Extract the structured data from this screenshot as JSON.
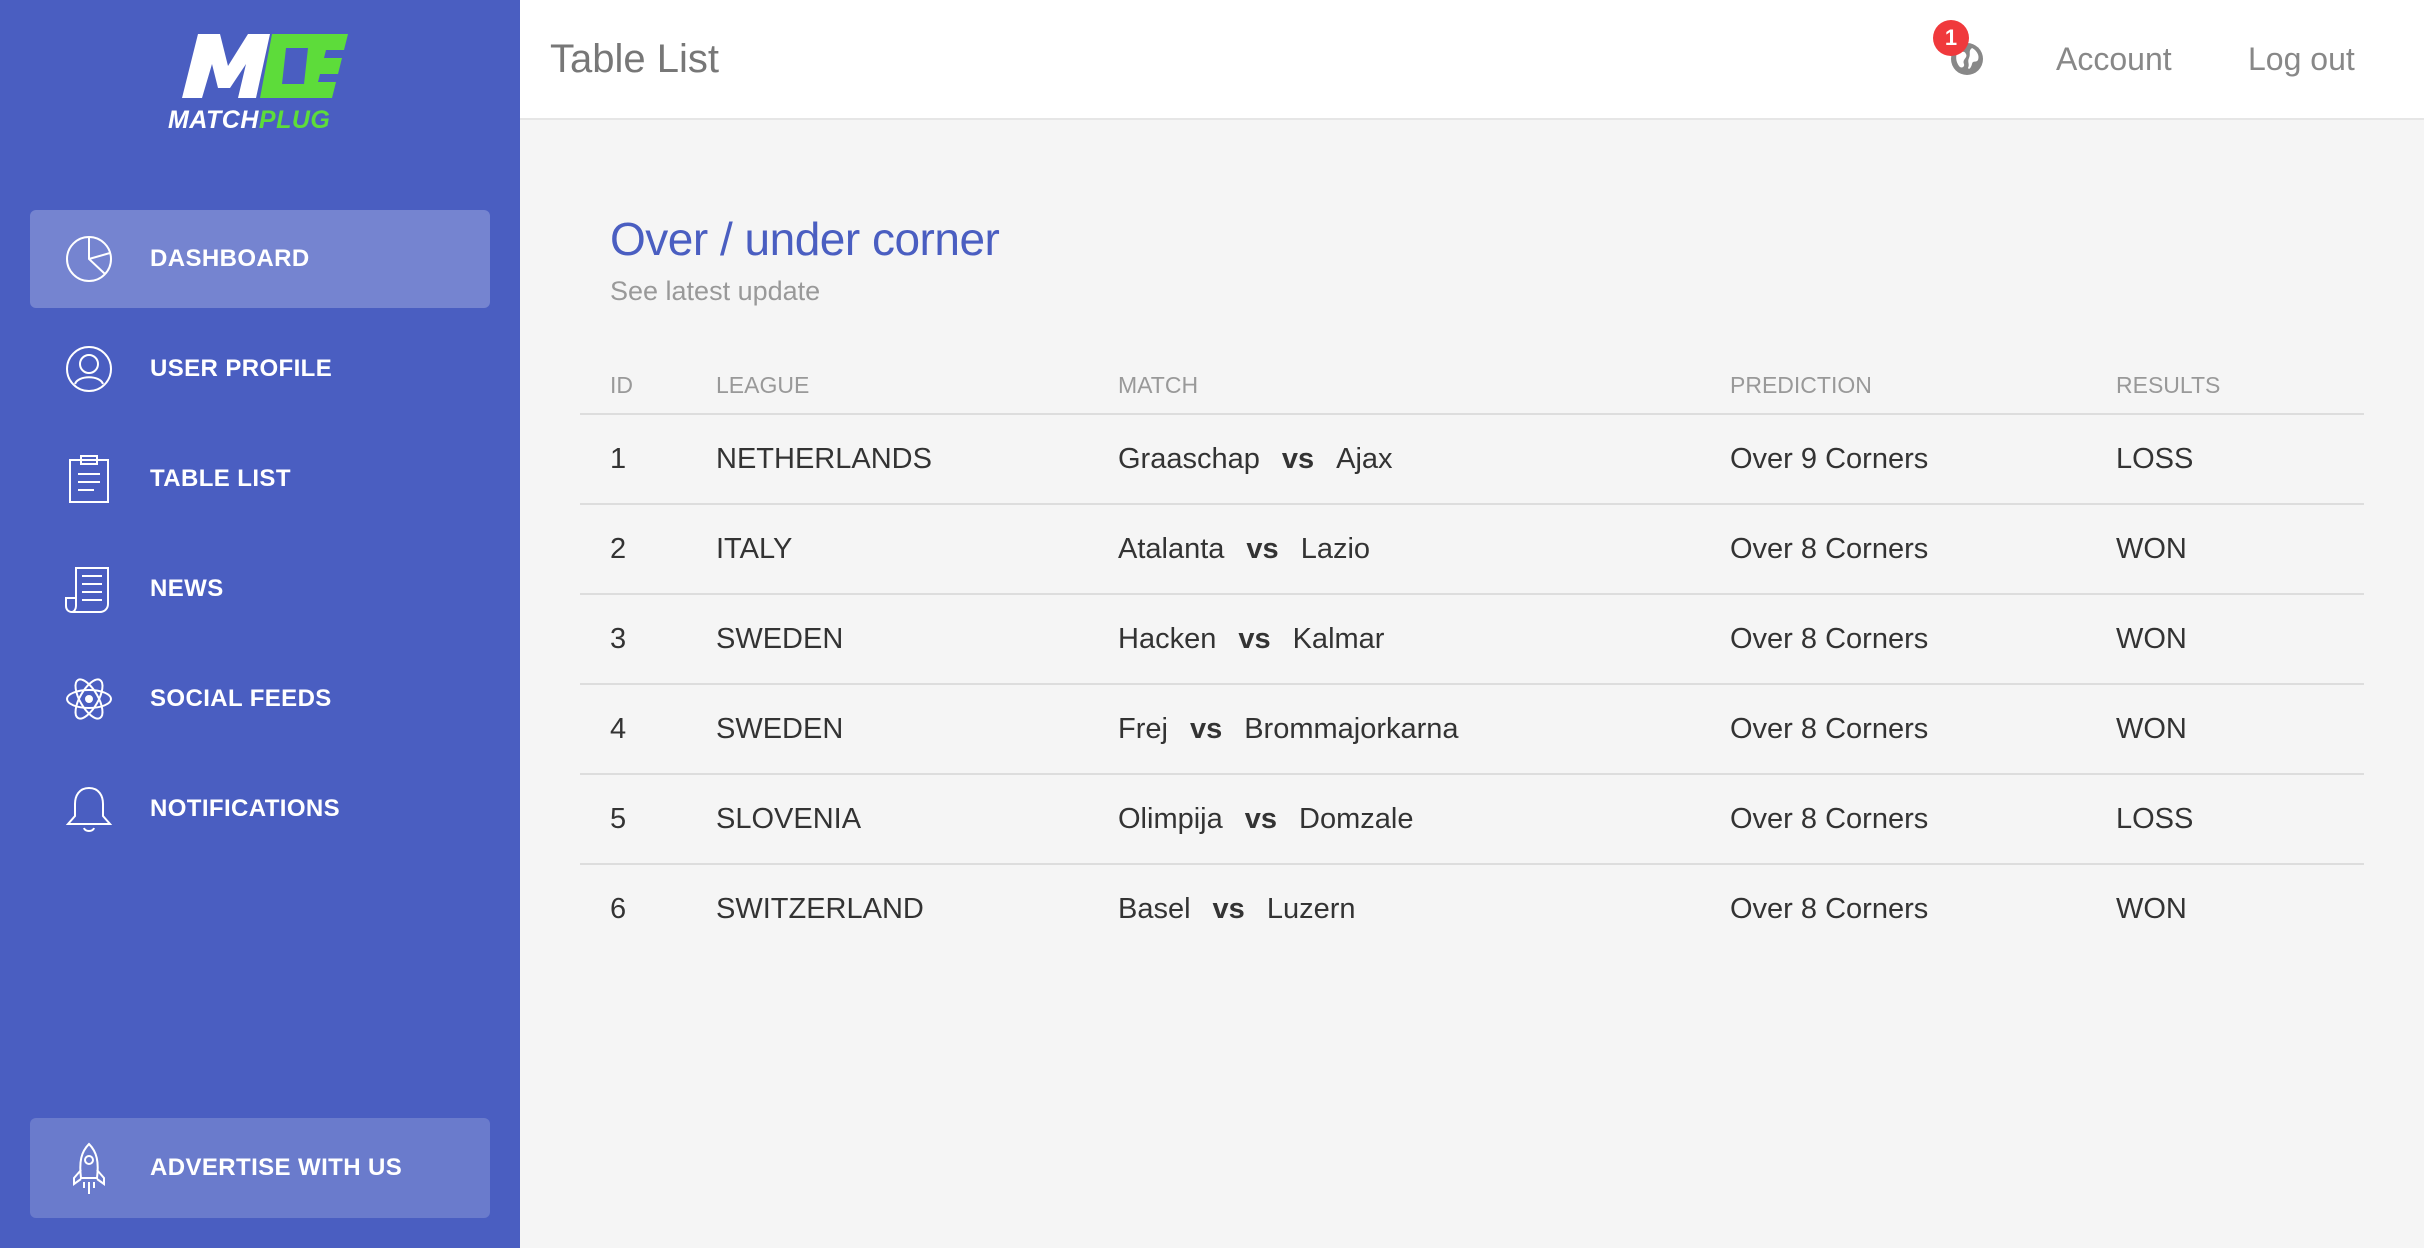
{
  "brand": {
    "logo_part1": "MATCH",
    "logo_part2": "PLUG",
    "colors": {
      "sidebar": "#4a5ec1",
      "accent_green": "#5ddc3a",
      "badge": "#f0393c"
    }
  },
  "sidebar": {
    "items": [
      {
        "label": "DASHBOARD",
        "icon": "pie-chart-icon",
        "active": true
      },
      {
        "label": "USER PROFILE",
        "icon": "user-icon"
      },
      {
        "label": "TABLE LIST",
        "icon": "clipboard-icon"
      },
      {
        "label": "NEWS",
        "icon": "newspaper-icon"
      },
      {
        "label": "SOCIAL FEEDS",
        "icon": "atom-icon"
      },
      {
        "label": "NOTIFICATIONS",
        "icon": "bell-icon"
      }
    ],
    "advertise": {
      "label": "ADVERTISE WITH US",
      "icon": "rocket-icon"
    }
  },
  "header": {
    "title": "Table List",
    "notification_count": "1",
    "account": "Account",
    "logout": "Log out"
  },
  "card": {
    "title": "Over / under corner",
    "subtitle": "See latest update"
  },
  "table": {
    "headers": [
      "ID",
      "LEAGUE",
      "MATCH",
      "PREDICTION",
      "RESULTS"
    ],
    "vs": "vs",
    "rows": [
      {
        "id": "1",
        "league": "NETHERLANDS",
        "home": "Graaschap",
        "away": "Ajax",
        "prediction": "Over 9 Corners",
        "result": "LOSS"
      },
      {
        "id": "2",
        "league": "ITALY",
        "home": "Atalanta",
        "away": "Lazio",
        "prediction": "Over 8 Corners",
        "result": "WON"
      },
      {
        "id": "3",
        "league": "SWEDEN",
        "home": "Hacken",
        "away": "Kalmar",
        "prediction": "Over 8 Corners",
        "result": "WON"
      },
      {
        "id": "4",
        "league": "SWEDEN",
        "home": "Frej",
        "away": "Brommajorkarna",
        "prediction": "Over 8 Corners",
        "result": "WON"
      },
      {
        "id": "5",
        "league": "SLOVENIA",
        "home": "Olimpija",
        "away": "Domzale",
        "prediction": "Over 8 Corners",
        "result": "LOSS"
      },
      {
        "id": "6",
        "league": "SWITZERLAND",
        "home": "Basel",
        "away": "Luzern",
        "prediction": "Over 8 Corners",
        "result": "WON"
      }
    ]
  }
}
